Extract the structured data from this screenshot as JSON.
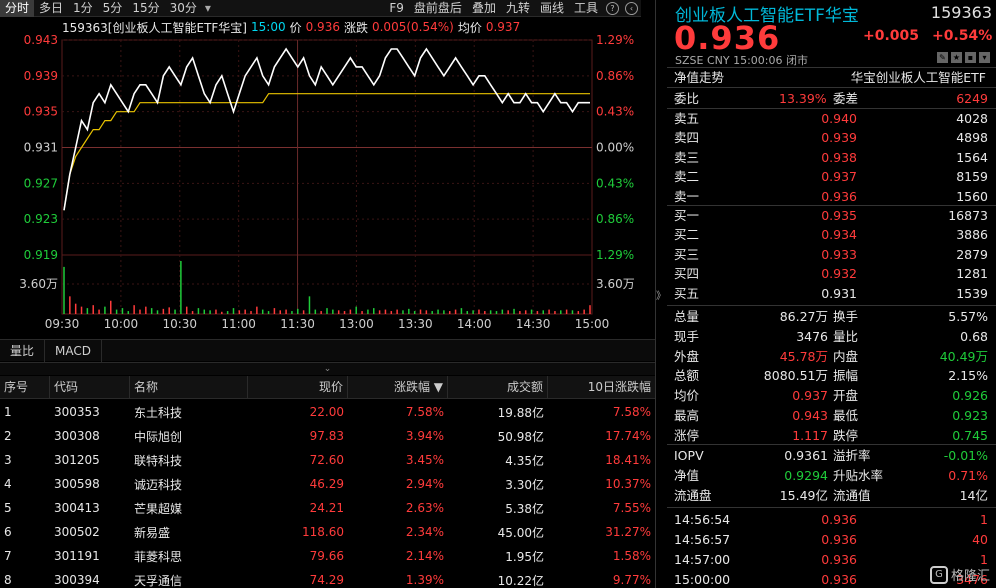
{
  "toolbar": {
    "tabs": [
      "分时",
      "多日",
      "1分",
      "5分",
      "15分",
      "30分"
    ],
    "arrow": "▾",
    "right_items": [
      "F9",
      "盘前盘后",
      "叠加",
      "九转",
      "画线",
      "工具"
    ],
    "icons": [
      "help-icon",
      "back-icon"
    ]
  },
  "ticker": {
    "code_name": "159363[创业板人工智能ETF华宝]",
    "time": "15:00",
    "price_label": "价",
    "price": "0.936",
    "change_label": "涨跌",
    "change": "0.005(0.54%)",
    "avg_label": "均价",
    "avg": "0.937"
  },
  "chart_data": {
    "type": "line",
    "title": "",
    "x_ticks": [
      "09:30",
      "10:00",
      "10:30",
      "11:00",
      "11:30",
      "13:00",
      "13:30",
      "14:00",
      "14:30",
      "15:00"
    ],
    "y_ticks_left": [
      "0.943",
      "0.939",
      "0.935",
      "0.931",
      "0.927",
      "0.923",
      "0.919"
    ],
    "y_ticks_right": [
      "1.29%",
      "0.86%",
      "0.43%",
      "0.00%",
      "0.43%",
      "0.86%",
      "1.29%"
    ],
    "prev_close": 0.931,
    "ylim": [
      0.919,
      0.943
    ],
    "volume_label_left": "3.60万",
    "volume_label_right": "3.60万",
    "series": [
      {
        "values": [
          0.924,
          0.928,
          0.931,
          0.934,
          0.933,
          0.936,
          0.937,
          0.936,
          0.938,
          0.937,
          0.936,
          0.935,
          0.937,
          0.938,
          0.938,
          0.937,
          0.936,
          0.939,
          0.94,
          0.939,
          0.938,
          0.94,
          0.941,
          0.939,
          0.937,
          0.936,
          0.938,
          0.939,
          0.937,
          0.935,
          0.937,
          0.939,
          0.94,
          0.941,
          0.939,
          0.938,
          0.94,
          0.941,
          0.942,
          0.941,
          0.94,
          0.941,
          0.939,
          0.938,
          0.94,
          0.939,
          0.938,
          0.939,
          0.94,
          0.941,
          0.94,
          0.94,
          0.939,
          0.938,
          0.939,
          0.941,
          0.942,
          0.942,
          0.941,
          0.94,
          0.939,
          0.941,
          0.942,
          0.941,
          0.94,
          0.939,
          0.94,
          0.941,
          0.94,
          0.939,
          0.938,
          0.939,
          0.939,
          0.938,
          0.937,
          0.936,
          0.937,
          0.936,
          0.936,
          0.937,
          0.936,
          0.936,
          0.935,
          0.936,
          0.937,
          0.936,
          0.936,
          0.935,
          0.936,
          0.936,
          0.936
        ]
      },
      {
        "values": [
          0.924,
          0.928,
          0.93,
          0.931,
          0.932,
          0.933,
          0.933,
          0.934,
          0.934,
          0.935,
          0.935,
          0.935,
          0.935,
          0.936,
          0.936,
          0.936,
          0.936,
          0.936,
          0.936,
          0.936,
          0.936,
          0.936,
          0.936,
          0.936,
          0.936,
          0.936,
          0.936,
          0.936,
          0.936,
          0.936,
          0.936,
          0.936,
          0.936,
          0.936,
          0.936,
          0.937,
          0.937,
          0.937,
          0.937,
          0.937,
          0.937,
          0.937,
          0.937,
          0.937,
          0.937,
          0.937,
          0.937,
          0.937,
          0.937,
          0.937,
          0.937,
          0.937,
          0.937,
          0.937,
          0.937,
          0.937,
          0.937,
          0.937,
          0.937,
          0.937,
          0.937,
          0.937,
          0.937,
          0.937,
          0.937,
          0.937,
          0.937,
          0.937,
          0.937,
          0.937,
          0.937,
          0.937,
          0.937,
          0.937,
          0.937,
          0.937,
          0.937,
          0.937,
          0.937,
          0.937,
          0.937,
          0.937,
          0.937,
          0.937,
          0.937,
          0.937,
          0.937,
          0.937,
          0.937,
          0.937,
          0.937
        ]
      }
    ],
    "volume_max": 36000,
    "volume": [
      32000,
      12000,
      7000,
      5000,
      4000,
      6000,
      3000,
      5000,
      9000,
      3000,
      4000,
      2000,
      6000,
      3000,
      5000,
      4000,
      2500,
      3500,
      4500,
      3000,
      36000,
      5000,
      2000,
      4000,
      3000,
      2500,
      3000,
      1500,
      2000,
      4000,
      2500,
      3000,
      2000,
      5000,
      3000,
      2000,
      4000,
      2500,
      3000,
      2000,
      3500,
      2500,
      12000,
      3000,
      2000,
      4000,
      3000,
      2500,
      2000,
      3000,
      5000,
      2000,
      3000,
      4000,
      2500,
      3000,
      2000,
      3000,
      2500,
      3500,
      2000,
      3000,
      2500,
      2000,
      3000,
      2500,
      2000,
      3000,
      4000,
      2000,
      2500,
      3000,
      2000,
      2500,
      2000,
      3000,
      2500,
      3500,
      2000,
      2500,
      3000,
      2000,
      2500,
      3000,
      2000,
      2500,
      3000,
      2500,
      2000,
      3000,
      6000
    ],
    "colors": {
      "price": "#ffffff",
      "avg": "#e8c200",
      "up": "#ff3b3b",
      "down": "#1fcc3a",
      "grid": "#3a1a1a"
    }
  },
  "subtabs": [
    "量比",
    "MACD"
  ],
  "collapse": "⌄",
  "table": {
    "headers": [
      "序号",
      "代码",
      "名称",
      "现价",
      "涨跌幅 ▼",
      "成交额",
      "10日涨跌幅"
    ],
    "rows": [
      [
        "1",
        "300353",
        "东土科技",
        "22.00",
        "7.58%",
        "19.88亿",
        "7.58%"
      ],
      [
        "2",
        "300308",
        "中际旭创",
        "97.83",
        "3.94%",
        "50.98亿",
        "17.74%"
      ],
      [
        "3",
        "301205",
        "联特科技",
        "72.60",
        "3.45%",
        "4.35亿",
        "18.41%"
      ],
      [
        "4",
        "300598",
        "诚迈科技",
        "46.29",
        "2.94%",
        "3.30亿",
        "10.37%"
      ],
      [
        "5",
        "300413",
        "芒果超媒",
        "24.21",
        "2.63%",
        "5.38亿",
        "7.55%"
      ],
      [
        "6",
        "300502",
        "新易盛",
        "118.60",
        "2.34%",
        "45.00亿",
        "31.27%"
      ],
      [
        "7",
        "301191",
        "菲菱科思",
        "79.66",
        "2.14%",
        "1.95亿",
        "1.58%"
      ],
      [
        "8",
        "300394",
        "天孚通信",
        "74.29",
        "1.39%",
        "10.22亿",
        "9.77%"
      ]
    ]
  },
  "sidebar_toggle": "》",
  "quote": {
    "title": "创业板人工智能ETF华宝",
    "code": "159363",
    "price": "0.936",
    "change": "+0.005",
    "change_pct": "+0.54%",
    "meta": "SZSE  CNY  15:00:06  闭市",
    "net_label": "净值走势",
    "net_name": "华宝创业板人工智能ETF",
    "wb_label": "委比",
    "wb_value": "13.39%",
    "wc_label": "委差",
    "wc_value": "6249",
    "sells": [
      {
        "label": "卖五",
        "price": "0.940",
        "vol": "4028"
      },
      {
        "label": "卖四",
        "price": "0.939",
        "vol": "4898"
      },
      {
        "label": "卖三",
        "price": "0.938",
        "vol": "1564"
      },
      {
        "label": "卖二",
        "price": "0.937",
        "vol": "8159"
      },
      {
        "label": "卖一",
        "price": "0.936",
        "vol": "1560"
      }
    ],
    "buys": [
      {
        "label": "买一",
        "price": "0.935",
        "vol": "16873"
      },
      {
        "label": "买二",
        "price": "0.934",
        "vol": "3886"
      },
      {
        "label": "买三",
        "price": "0.933",
        "vol": "2879"
      },
      {
        "label": "买四",
        "price": "0.932",
        "vol": "1281"
      },
      {
        "label": "买五",
        "price": "0.931",
        "vol": "1539"
      }
    ],
    "stats": [
      {
        "l1": "总量",
        "v1": "86.27万",
        "c1": "white",
        "l2": "换手",
        "v2": "5.57%",
        "c2": "white"
      },
      {
        "l1": "现手",
        "v1": "3476",
        "c1": "white",
        "l2": "量比",
        "v2": "0.68",
        "c2": "white"
      },
      {
        "l1": "外盘",
        "v1": "45.78万",
        "c1": "red",
        "l2": "内盘",
        "v2": "40.49万",
        "c2": "green"
      },
      {
        "l1": "总额",
        "v1": "8080.51万",
        "c1": "white",
        "l2": "振幅",
        "v2": "2.15%",
        "c2": "white"
      },
      {
        "l1": "均价",
        "v1": "0.937",
        "c1": "red",
        "l2": "开盘",
        "v2": "0.926",
        "c2": "green"
      },
      {
        "l1": "最高",
        "v1": "0.943",
        "c1": "red",
        "l2": "最低",
        "v2": "0.923",
        "c2": "green"
      },
      {
        "l1": "涨停",
        "v1": "1.117",
        "c1": "red",
        "l2": "跌停",
        "v2": "0.745",
        "c2": "green"
      }
    ],
    "stats2": [
      {
        "l1": "IOPV",
        "v1": "0.9361",
        "c1": "white",
        "l2": "溢折率",
        "v2": "-0.01%",
        "c2": "green"
      },
      {
        "l1": "净值",
        "v1": "0.9294",
        "c1": "green",
        "l2": "升贴水率",
        "v2": "0.71%",
        "c2": "red"
      },
      {
        "l1": "流通盘",
        "v1": "15.49亿",
        "c1": "white",
        "l2": "流通值",
        "v2": "14亿",
        "c2": "white"
      }
    ],
    "ticks": [
      {
        "time": "14:56:54",
        "price": "0.936",
        "vol": "1"
      },
      {
        "time": "14:56:57",
        "price": "0.936",
        "vol": "40"
      },
      {
        "time": "14:57:00",
        "price": "0.936",
        "vol": "1"
      },
      {
        "time": "15:00:00",
        "price": "0.936",
        "vol": "3476"
      }
    ]
  },
  "watermark": "格隆汇"
}
